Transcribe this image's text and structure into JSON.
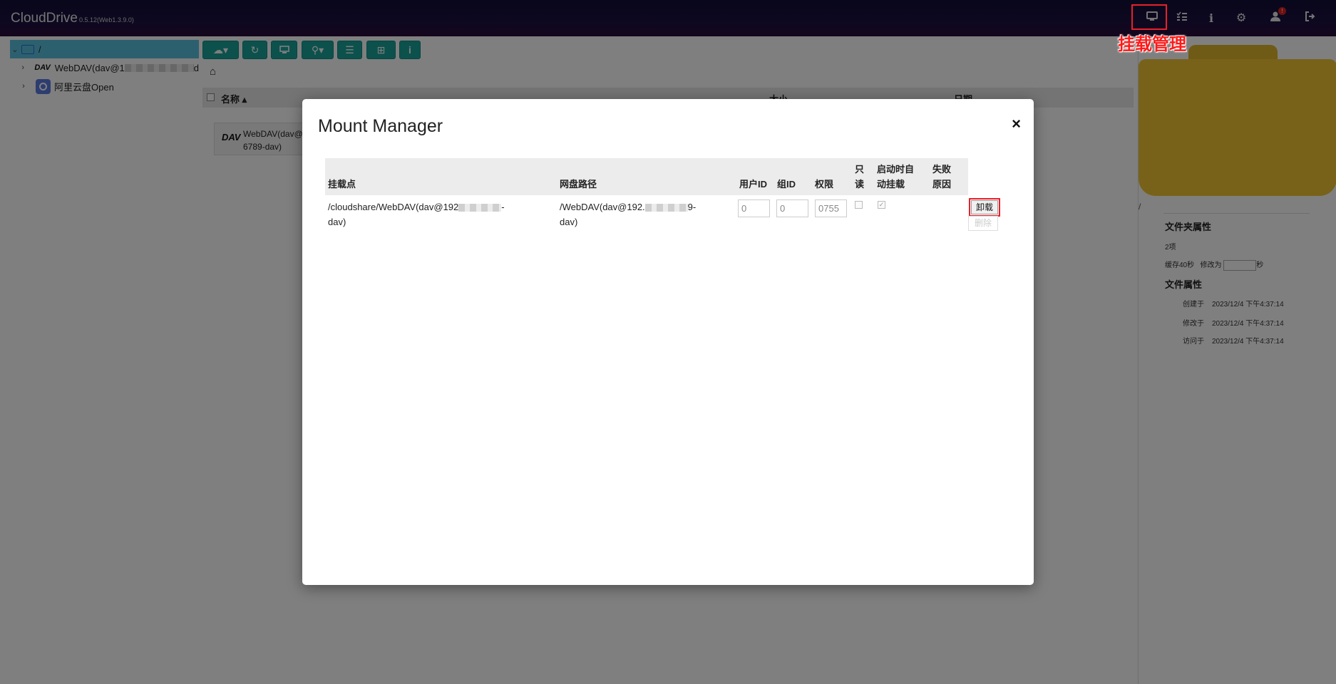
{
  "app": {
    "title": "CloudDrive",
    "version": "0.5.12(Web1.3.9.0)"
  },
  "header_icons": [
    "mount-manager-icon",
    "tasks-icon",
    "info-icon",
    "settings-icon",
    "user-icon",
    "logout-icon"
  ],
  "user_badge": "!",
  "annotation": "挂载管理",
  "tree": {
    "root": "/",
    "items": [
      {
        "label_start": "WebDAV(dav@1",
        "label_end": "d"
      },
      {
        "label": "阿里云盘Open"
      }
    ]
  },
  "list": {
    "col_name": "名称",
    "col_size": "大小",
    "col_date": "日期",
    "items": [
      {
        "line1": "WebDAV(dav@",
        "line2": "6789-dav)"
      }
    ]
  },
  "right_panel": {
    "path": "/",
    "folder_props_title": "文件夹属性",
    "item_count": "2项",
    "cache_text": "缓存40秒",
    "modify_label": "修改为",
    "seconds_unit": "秒",
    "file_props_title": "文件属性",
    "created_label": "创建于",
    "created": "2023/12/4 下午4:37:14",
    "modified_label": "修改于",
    "modified": "2023/12/4 下午4:37:14",
    "accessed_label": "访问于",
    "accessed": "2023/12/4 下午4:37:14"
  },
  "modal": {
    "title": "Mount Manager",
    "close": "×",
    "headers": {
      "mount_point": "挂载点",
      "cloud_path": "网盘路径",
      "user_id": "用户ID",
      "group_id": "组ID",
      "permission": "权限",
      "readonly_1": "只",
      "readonly_2": "读",
      "auto_mount_1": "启动时自",
      "auto_mount_2": "动挂载",
      "fail_reason_1": "失败",
      "fail_reason_2": "原因"
    },
    "row": {
      "mount_point_line1": "/cloudshare/WebDAV(dav@192",
      "mount_point_line1_end": "-",
      "mount_point_line2": "dav)",
      "cloud_path_line1": "/WebDAV(dav@192.",
      "cloud_path_line1_end": "9-",
      "cloud_path_line2": "dav)",
      "user_id": "0",
      "group_id": "0",
      "permission": "0755",
      "readonly": false,
      "auto_mount": true,
      "unmount_label": "卸载",
      "delete_label": "删除"
    }
  }
}
